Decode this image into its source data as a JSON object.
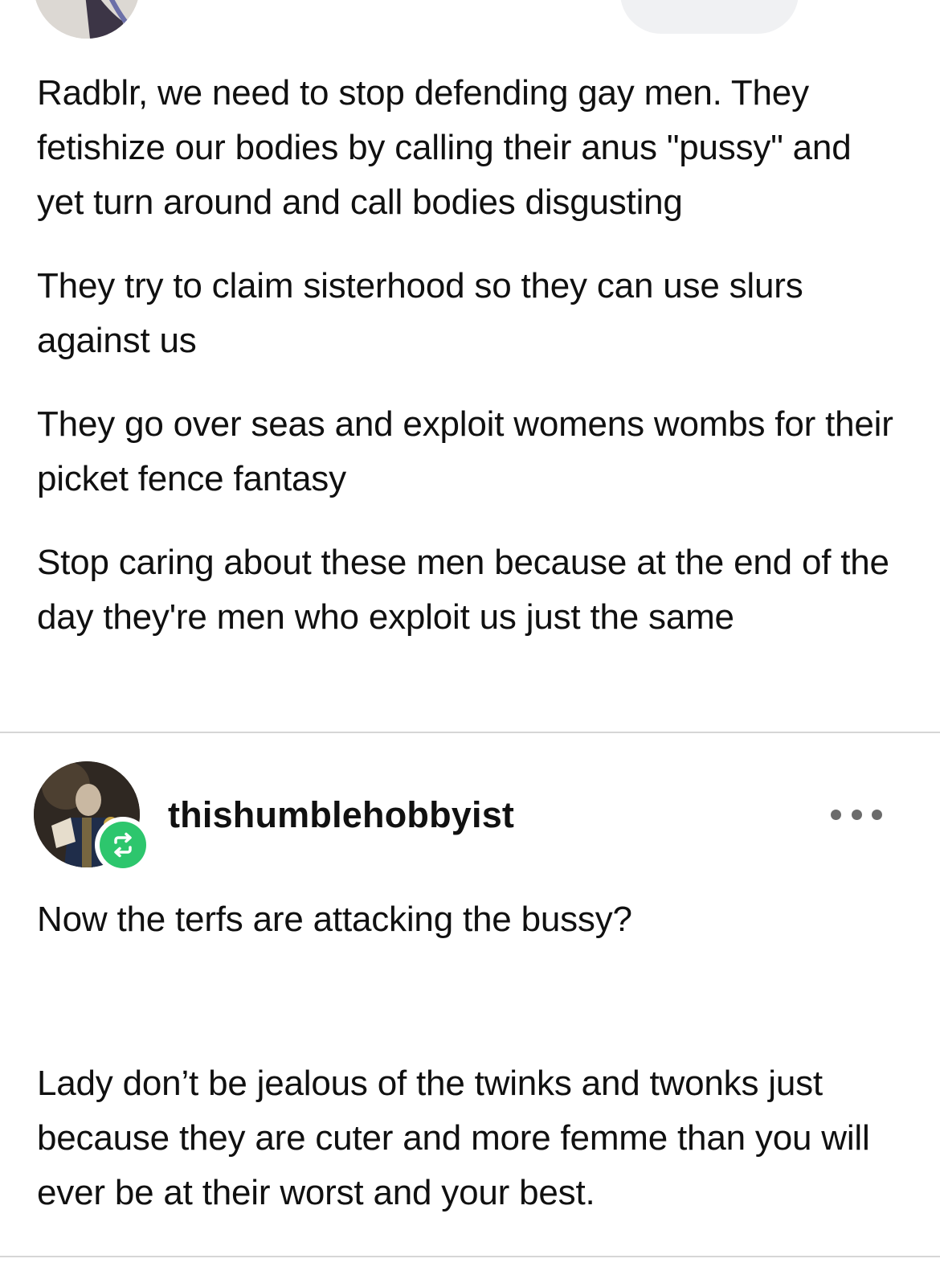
{
  "original_post": {
    "paragraphs": [
      "Radblr, we need to stop defending gay men. They fetishize our bodies by calling their anus \"pussy\" and yet turn around and call bodies disgusting",
      "They try to claim sisterhood so they can use slurs against us",
      "They go over seas and exploit womens wombs for their picket fence fantasy",
      "Stop caring about these men because at the end of the day they're men who exploit us just the same"
    ]
  },
  "reblog": {
    "username": "thishumblehobbyist",
    "badge_icon": "reblog-icon",
    "badge_color": "#2dc66d",
    "more_icon": "more-options-icon",
    "paragraphs": [
      "Now the terfs are attacking the bussy?",
      "Lady don’t be jealous of the twinks and twonks just because they are cuter and more femme than you will ever be at their worst and your best."
    ]
  }
}
